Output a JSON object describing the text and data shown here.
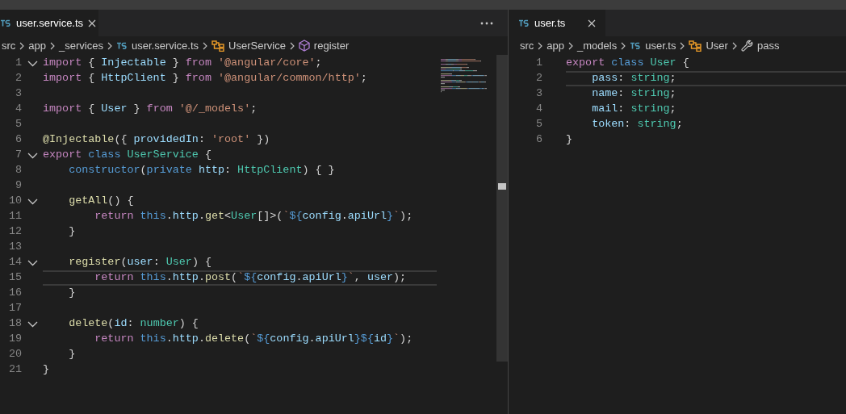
{
  "editor_groups": [
    {
      "tab": {
        "label": "user.service.ts",
        "selected": true
      },
      "breadcrumbs": [
        {
          "kind": "folder",
          "text": "src"
        },
        {
          "kind": "folder",
          "text": "app"
        },
        {
          "kind": "folder",
          "text": "_services"
        },
        {
          "kind": "file",
          "text": "user.service.ts"
        },
        {
          "kind": "class",
          "text": "UserService"
        },
        {
          "kind": "method",
          "text": "register"
        }
      ],
      "lines": [
        {
          "number": "1",
          "foldable": true,
          "current": false,
          "tokens": [
            {
              "kind": "kw",
              "text": "import"
            },
            {
              "kind": "p",
              "text": " { "
            },
            {
              "kind": "var",
              "text": "Injectable"
            },
            {
              "kind": "p",
              "text": " } "
            },
            {
              "kind": "kw",
              "text": "from"
            },
            {
              "kind": "str",
              "text": " '@angular/core'"
            },
            {
              "kind": "p",
              "text": ";"
            }
          ]
        },
        {
          "number": "2",
          "foldable": false,
          "current": false,
          "tokens": [
            {
              "kind": "kw",
              "text": "import"
            },
            {
              "kind": "p",
              "text": " { "
            },
            {
              "kind": "var",
              "text": "HttpClient"
            },
            {
              "kind": "p",
              "text": " } "
            },
            {
              "kind": "kw",
              "text": "from"
            },
            {
              "kind": "str",
              "text": " '@angular/common/http'"
            },
            {
              "kind": "p",
              "text": ";"
            }
          ]
        },
        {
          "number": "3",
          "foldable": false,
          "current": false
        },
        {
          "number": "4",
          "foldable": false,
          "current": false,
          "tokens": [
            {
              "kind": "kw",
              "text": "import"
            },
            {
              "kind": "p",
              "text": " { "
            },
            {
              "kind": "var",
              "text": "User"
            },
            {
              "kind": "p",
              "text": " } "
            },
            {
              "kind": "kw",
              "text": "from"
            },
            {
              "kind": "str",
              "text": " '@/_models'"
            },
            {
              "kind": "p",
              "text": ";"
            }
          ]
        },
        {
          "number": "5",
          "foldable": false,
          "current": false
        },
        {
          "number": "6",
          "foldable": false,
          "current": false,
          "tokens": [
            {
              "kind": "fn",
              "text": "@Injectable"
            },
            {
              "kind": "p",
              "text": "({ "
            },
            {
              "kind": "var",
              "text": "providedIn"
            },
            {
              "kind": "p",
              "text": ": "
            },
            {
              "kind": "str",
              "text": "'root'"
            },
            {
              "kind": "p",
              "text": " })"
            }
          ]
        },
        {
          "number": "7",
          "foldable": true,
          "current": false,
          "tokens": [
            {
              "kind": "kw",
              "text": "export"
            },
            {
              "kind": "st",
              "text": " class"
            },
            {
              "kind": "ty",
              "text": " UserService"
            },
            {
              "kind": "p",
              "text": " {"
            }
          ]
        },
        {
          "number": "8",
          "foldable": false,
          "current": false,
          "tokens": [
            {
              "kind": "st",
              "text": "    constructor"
            },
            {
              "kind": "p",
              "text": "("
            },
            {
              "kind": "st",
              "text": "private"
            },
            {
              "kind": "var",
              "text": " http"
            },
            {
              "kind": "p",
              "text": ": "
            },
            {
              "kind": "ty",
              "text": "HttpClient"
            },
            {
              "kind": "p",
              "text": ") { }"
            }
          ]
        },
        {
          "number": "9",
          "foldable": false,
          "current": false
        },
        {
          "number": "10",
          "foldable": true,
          "current": false,
          "tokens": [
            {
              "kind": "fn",
              "text": "    getAll"
            },
            {
              "kind": "p",
              "text": "() {"
            }
          ]
        },
        {
          "number": "11",
          "foldable": false,
          "current": false,
          "tokens": [
            {
              "kind": "kw",
              "text": "        return"
            },
            {
              "kind": "st",
              "text": " this"
            },
            {
              "kind": "p",
              "text": "."
            },
            {
              "kind": "var",
              "text": "http"
            },
            {
              "kind": "p",
              "text": "."
            },
            {
              "kind": "fn",
              "text": "get"
            },
            {
              "kind": "p",
              "text": "<"
            },
            {
              "kind": "ty",
              "text": "User"
            },
            {
              "kind": "p",
              "text": "[]>("
            },
            {
              "kind": "str",
              "text": "`"
            },
            {
              "kind": "st",
              "text": "${"
            },
            {
              "kind": "var",
              "text": "config"
            },
            {
              "kind": "p",
              "text": "."
            },
            {
              "kind": "var",
              "text": "apiUrl"
            },
            {
              "kind": "st",
              "text": "}"
            },
            {
              "kind": "str",
              "text": "`"
            },
            {
              "kind": "p",
              "text": ");"
            }
          ]
        },
        {
          "number": "12",
          "foldable": false,
          "current": false,
          "tokens": [
            {
              "kind": "p",
              "text": "    }"
            }
          ]
        },
        {
          "number": "13",
          "foldable": false,
          "current": false
        },
        {
          "number": "14",
          "foldable": true,
          "current": false,
          "tokens": [
            {
              "kind": "fn",
              "text": "    register"
            },
            {
              "kind": "p",
              "text": "("
            },
            {
              "kind": "var",
              "text": "user"
            },
            {
              "kind": "p",
              "text": ": "
            },
            {
              "kind": "ty",
              "text": "User"
            },
            {
              "kind": "p",
              "text": ") {"
            }
          ]
        },
        {
          "number": "15",
          "foldable": false,
          "current": true,
          "tokens": [
            {
              "kind": "kw",
              "text": "        return"
            },
            {
              "kind": "st",
              "text": " this"
            },
            {
              "kind": "p",
              "text": "."
            },
            {
              "kind": "var",
              "text": "http"
            },
            {
              "kind": "p",
              "text": "."
            },
            {
              "kind": "fn",
              "text": "post"
            },
            {
              "kind": "p",
              "text": "("
            },
            {
              "kind": "str",
              "text": "`"
            },
            {
              "kind": "st",
              "text": "${"
            },
            {
              "kind": "var",
              "text": "config"
            },
            {
              "kind": "p",
              "text": "."
            },
            {
              "kind": "var",
              "text": "apiUrl"
            },
            {
              "kind": "st",
              "text": "}"
            },
            {
              "kind": "str",
              "text": "`"
            },
            {
              "kind": "p",
              "text": ", "
            },
            {
              "kind": "var",
              "text": "user"
            },
            {
              "kind": "p",
              "text": ");"
            }
          ]
        },
        {
          "number": "16",
          "foldable": false,
          "current": false,
          "tokens": [
            {
              "kind": "p",
              "text": "    }"
            }
          ]
        },
        {
          "number": "17",
          "foldable": false,
          "current": false
        },
        {
          "number": "18",
          "foldable": true,
          "current": false,
          "tokens": [
            {
              "kind": "fn",
              "text": "    delete"
            },
            {
              "kind": "p",
              "text": "("
            },
            {
              "kind": "var",
              "text": "id"
            },
            {
              "kind": "p",
              "text": ": "
            },
            {
              "kind": "ty",
              "text": "number"
            },
            {
              "kind": "p",
              "text": ") {"
            }
          ]
        },
        {
          "number": "19",
          "foldable": false,
          "current": false,
          "tokens": [
            {
              "kind": "kw",
              "text": "        return"
            },
            {
              "kind": "st",
              "text": " this"
            },
            {
              "kind": "p",
              "text": "."
            },
            {
              "kind": "var",
              "text": "http"
            },
            {
              "kind": "p",
              "text": "."
            },
            {
              "kind": "fn",
              "text": "delete"
            },
            {
              "kind": "p",
              "text": "("
            },
            {
              "kind": "str",
              "text": "`"
            },
            {
              "kind": "st",
              "text": "${"
            },
            {
              "kind": "var",
              "text": "config"
            },
            {
              "kind": "p",
              "text": "."
            },
            {
              "kind": "var",
              "text": "apiUrl"
            },
            {
              "kind": "st",
              "text": "}${"
            },
            {
              "kind": "var",
              "text": "id"
            },
            {
              "kind": "st",
              "text": "}"
            },
            {
              "kind": "str",
              "text": "`"
            },
            {
              "kind": "p",
              "text": ");"
            }
          ]
        },
        {
          "number": "20",
          "foldable": false,
          "current": false,
          "tokens": [
            {
              "kind": "p",
              "text": "    }"
            }
          ]
        },
        {
          "number": "21",
          "foldable": false,
          "current": false,
          "tokens": [
            {
              "kind": "p",
              "text": "}"
            }
          ]
        }
      ]
    },
    {
      "tab": {
        "label": "user.ts",
        "selected": true
      },
      "breadcrumbs": [
        {
          "kind": "folder",
          "text": "src"
        },
        {
          "kind": "folder",
          "text": "app"
        },
        {
          "kind": "folder",
          "text": "_models"
        },
        {
          "kind": "file",
          "text": "user.ts"
        },
        {
          "kind": "class",
          "text": "User"
        },
        {
          "kind": "property",
          "text": "pass"
        }
      ],
      "lines": [
        {
          "number": "1",
          "current": false,
          "tokens": [
            {
              "kind": "kw",
              "text": "export"
            },
            {
              "kind": "st",
              "text": " class"
            },
            {
              "kind": "ty",
              "text": " User"
            },
            {
              "kind": "p",
              "text": " {"
            }
          ]
        },
        {
          "number": "2",
          "current": true,
          "tokens": [
            {
              "kind": "var",
              "text": "    pass"
            },
            {
              "kind": "p",
              "text": ": "
            },
            {
              "kind": "ty",
              "text": "string"
            },
            {
              "kind": "p",
              "text": ";"
            }
          ]
        },
        {
          "number": "3",
          "current": false,
          "tokens": [
            {
              "kind": "var",
              "text": "    name"
            },
            {
              "kind": "p",
              "text": ": "
            },
            {
              "kind": "ty",
              "text": "string"
            },
            {
              "kind": "p",
              "text": ";"
            }
          ]
        },
        {
          "number": "4",
          "current": false,
          "tokens": [
            {
              "kind": "var",
              "text": "    mail"
            },
            {
              "kind": "p",
              "text": ": "
            },
            {
              "kind": "ty",
              "text": "string"
            },
            {
              "kind": "p",
              "text": ";"
            }
          ]
        },
        {
          "number": "5",
          "current": false,
          "tokens": [
            {
              "kind": "var",
              "text": "    token"
            },
            {
              "kind": "p",
              "text": ": "
            },
            {
              "kind": "ty",
              "text": "string"
            },
            {
              "kind": "p",
              "text": ";"
            }
          ]
        },
        {
          "number": "6",
          "current": false,
          "tokens": [
            {
              "kind": "p",
              "text": "}"
            }
          ]
        }
      ]
    }
  ]
}
